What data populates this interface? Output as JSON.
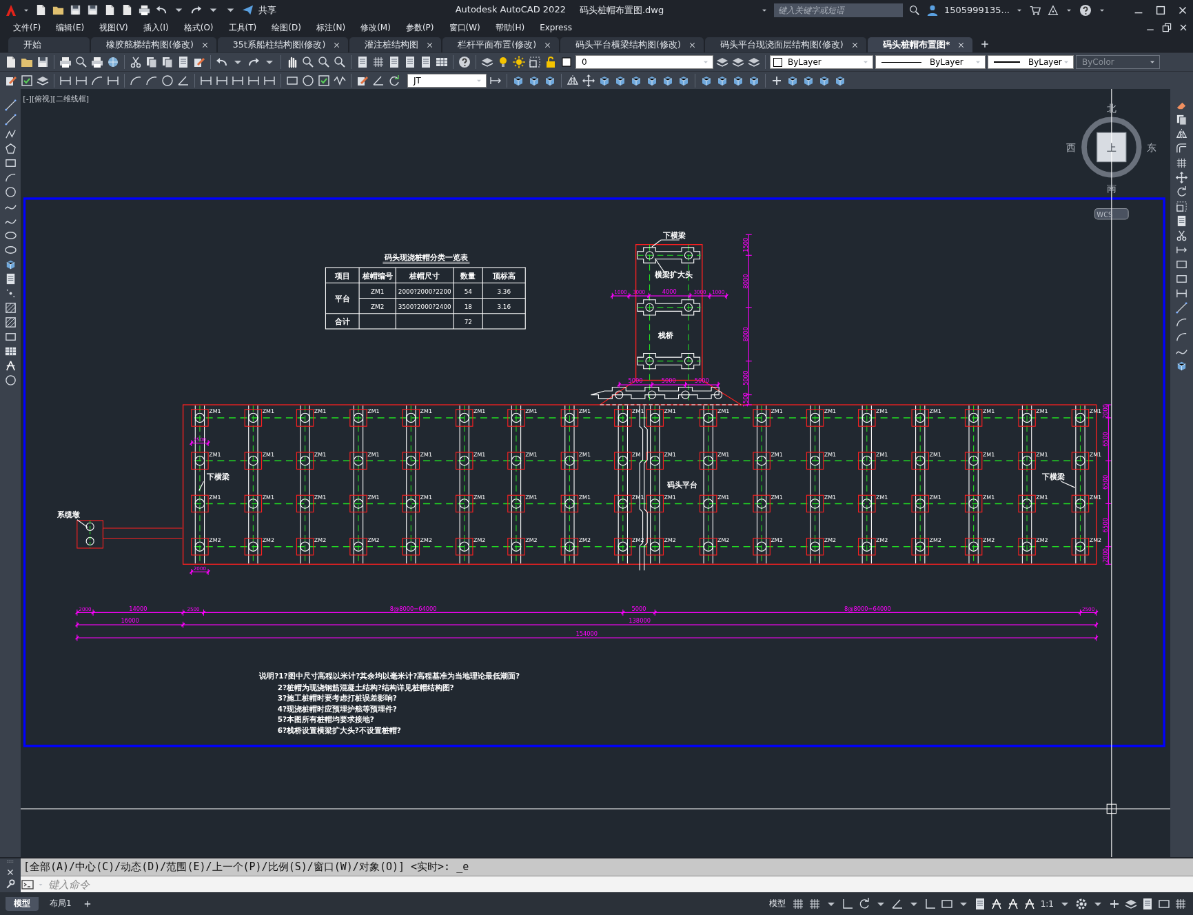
{
  "window": {
    "title": "Autodesk AutoCAD 2022",
    "filename": "码头桩帽布置图.dwg"
  },
  "quick_access": {
    "share": "共享"
  },
  "search": {
    "placeholder": "键入关键字或短语"
  },
  "user": {
    "name": "1505999135..."
  },
  "menu": [
    "文件(F)",
    "编辑(E)",
    "视图(V)",
    "插入(I)",
    "格式(O)",
    "工具(T)",
    "绘图(D)",
    "标注(N)",
    "修改(M)",
    "参数(P)",
    "窗口(W)",
    "帮助(H)",
    "Express"
  ],
  "file_tabs": [
    {
      "label": "开始",
      "selected": false,
      "closable": false
    },
    {
      "label": "橡胶舷梯结构图(修改)",
      "selected": false,
      "closable": true
    },
    {
      "label": "35t系船柱结构图(修改)",
      "selected": false,
      "closable": true
    },
    {
      "label": "灌注桩结构图",
      "selected": false,
      "closable": true
    },
    {
      "label": "栏杆平面布置(修改)",
      "selected": false,
      "closable": true
    },
    {
      "label": "码头平台横梁结构图(修改)",
      "selected": false,
      "closable": true
    },
    {
      "label": "码头平台现浇面层结构图(修改)",
      "selected": false,
      "closable": true
    },
    {
      "label": "码头桩帽布置图*",
      "selected": true,
      "closable": true
    }
  ],
  "layer_combo": {
    "value": "0"
  },
  "property_combos": [
    {
      "kind": "color",
      "value": "ByLayer",
      "disabled": false
    },
    {
      "kind": "linetype",
      "value": "ByLayer",
      "disabled": false
    },
    {
      "kind": "lineweight",
      "value": "ByLayer",
      "disabled": false
    },
    {
      "kind": "plotstyle",
      "value": "ByColor",
      "disabled": true
    }
  ],
  "dimstyle_combo": {
    "value": "JT"
  },
  "viewport": {
    "label": "[-][俯视][二维线框]"
  },
  "viewcube": {
    "north": "北",
    "south": "南",
    "east": "东",
    "west": "西",
    "face": "上",
    "ucs": "WCS"
  },
  "drawing": {
    "table": {
      "title": "码头现浇桩帽分类一览表",
      "header": [
        "项目",
        "桩帽编号",
        "桩帽尺寸",
        "数量",
        "顶标高"
      ],
      "group_label": "平台",
      "rows": [
        [
          "ZM1",
          "2000?2000?2200",
          "54",
          "3.36"
        ],
        [
          "ZM2",
          "3500?2000?2400",
          "18",
          "3.16"
        ]
      ],
      "total_label": "合计",
      "total_count": "72"
    },
    "labels": {
      "trestle_beam": "下横梁",
      "beam_head": "横梁扩大头",
      "trestle": "栈桥",
      "platform": "码头平台",
      "beam_left": "下横梁",
      "beam_right": "下横梁",
      "dolphin": "系缆墩"
    },
    "pile_labels": [
      [
        "ZM1",
        "ZM1",
        "ZM1",
        "ZM1",
        "ZM1",
        "ZM1",
        "ZM1",
        "ZM1",
        "ZM1",
        "ZM1",
        "ZM1",
        "ZM1",
        "ZM1",
        "ZM1",
        "ZM1",
        "ZM1",
        "ZM1",
        "ZM1"
      ],
      [
        "ZM1",
        "ZM1",
        "ZM1",
        "ZM1",
        "ZM1",
        "ZM1",
        "ZM1",
        "ZM1",
        "ZM",
        "ZM1",
        "ZM1",
        "ZM1",
        "ZM1",
        "ZM1",
        "ZM1",
        "ZM1",
        "ZM1",
        "ZM1"
      ],
      [
        "ZM1",
        "ZM1",
        "ZM1",
        "ZM1",
        "ZM1",
        "ZM1",
        "ZM1",
        "ZM1",
        "ZM1",
        "ZM1",
        "ZM1",
        "ZM1",
        "ZM1",
        "ZM1",
        "ZM1",
        "ZM1",
        "ZM1",
        "ZM1"
      ],
      [
        "ZM2",
        "ZM2",
        "ZM2",
        "ZM2",
        "ZM2",
        "ZM2",
        "ZM2",
        "ZM2",
        "ZM2",
        "ZM2",
        "ZM2",
        "ZM2",
        "ZM2",
        "ZM2",
        "ZM2",
        "ZM2",
        "ZM2",
        "ZM2"
      ]
    ],
    "dimensions": {
      "chain_1": [
        "2000",
        "14000",
        "2500",
        "8@8000=64000",
        "5000",
        "8@8000=64000",
        "2500"
      ],
      "chain_2": [
        "16000",
        "138000"
      ],
      "chain_3": [
        "154000"
      ],
      "trestle_vertical": [
        "1500",
        "8000",
        "8000",
        "5000",
        "1500"
      ],
      "trestle_beam": [
        "1000",
        "3000",
        "4000",
        "3000",
        "1000"
      ],
      "trestle_base": [
        "5000",
        "5000",
        "5000"
      ],
      "platform_vertical": [
        "2000",
        "6500",
        "6500",
        "6500",
        "2000"
      ],
      "pile_spacing": [
        "2500",
        "2000"
      ]
    },
    "notes": [
      "说明?1?图中尺寸高程以米计?其余均以毫米计?高程基准为当地理论最低潮面?",
      "2?桩帽为现浇钢筋混凝土结构?结构详见桩帽结构图?",
      "3?施工桩帽时要考虑打桩误差影响?",
      "4?现浇桩帽时应预埋护舷等预埋件?",
      "5?本图所有桩帽均要求接地?",
      "6?栈桥设置横梁扩大头?不设置桩帽?"
    ]
  },
  "command": {
    "history": "[全部(A)/中心(C)/动态(D)/范围(E)/上一个(P)/比例(S)/窗口(W)/对象(O)] <实时>: _e",
    "placeholder": "键入命令"
  },
  "layout_tabs": [
    {
      "label": "模型",
      "selected": true
    },
    {
      "label": "布局1",
      "selected": false
    }
  ],
  "status_bar": {
    "mode": "模型",
    "scale": "1:1"
  }
}
